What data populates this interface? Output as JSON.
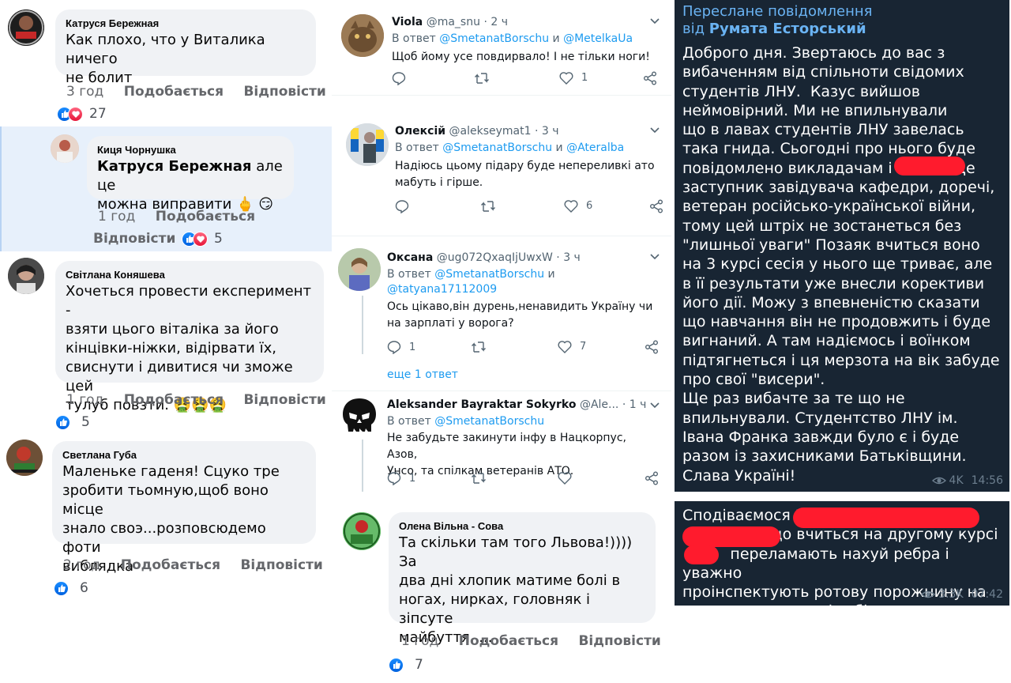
{
  "facebook": {
    "comments": [
      {
        "name": "Катруся Бережная",
        "text_lines": [
          "Как плохо, что у Виталика ничего",
          "не болит"
        ],
        "time": "3 год",
        "like": "Подобається",
        "reply": "Відповісти",
        "reactions": "27"
      },
      {
        "name": "Киця Чорнушка",
        "mention": "Катруся Бережная",
        "text_line1_rest": " але це",
        "text_line2": "можна виправити 🖕 😏",
        "time": "1 год",
        "like": "Подобається",
        "reply": "Відповісти",
        "reactions": "5"
      },
      {
        "name": "Світлана Коняшева",
        "text_lines": [
          "Хочеться провести експеримент -",
          "взяти цього віталіка за його",
          "кінцівки-ніжки, відірвати їх,",
          "свиснути і дивитися чи зможе цей",
          "тулуб повзти. 🤮🤮🤮"
        ],
        "time": "1 год",
        "like": "Подобається",
        "reply": "Відповісти",
        "reactions": "5"
      },
      {
        "name": "Светлана Губа",
        "text_lines": [
          "Маленьке гаденя! Сцуко тре",
          "зробити тьомную,щоб воно місце",
          "знало своэ...розповсюдемо фоти",
          "виблядка"
        ],
        "time": "2 год",
        "like": "Подобається",
        "reply": "Відповісти",
        "reactions": "6"
      },
      {
        "name": "Олена Вільна - Сова",
        "text_lines": [
          "Та скільки там того Львова!)))) За",
          "два дні хлопик матиме болі в",
          "ногах, нирках, головняк і зіпсуте",
          "майбуття. ..."
        ],
        "time": "1 год",
        "like": "Подобається",
        "reply": "Відповісти",
        "reactions": "7"
      }
    ]
  },
  "twitter": {
    "in_reply_word": "В ответ",
    "and_word": "и",
    "more_replies": "еще 1 ответ",
    "tweets": [
      {
        "name": "Viola",
        "handle": "@ma_snu",
        "dot": "·",
        "time": "2 ч",
        "reply_to_1": "@SmetanatBorschu",
        "reply_to_2": "@MetelkaUa",
        "text_lines": [
          "Щоб йому усе повдирвалo! І не тільки ноги!"
        ],
        "replies": "",
        "likes": "1"
      },
      {
        "name": "Олексій",
        "handle": "@alekseymat1",
        "dot": "·",
        "time": "3 ч",
        "reply_to_1": "@SmetanatBorschu",
        "reply_to_2": "@Ateralba",
        "text_lines": [
          "Надіюсь цьому підару буде непереливкі ато",
          "мабуть і гірше."
        ],
        "replies": "",
        "likes": "6"
      },
      {
        "name": "Оксана",
        "handle": "@ug072QxaqIjUwxW",
        "dot": "·",
        "time": "3 ч",
        "reply_to_1": "@SmetanatBorschu",
        "reply_to_2": "@tatyana17112009",
        "text_lines": [
          "Ось цікаво,він дурень,ненавидить Україну чи",
          "на зарплаті у ворога?"
        ],
        "replies": "1",
        "likes": "7"
      },
      {
        "name": "Aleksander Bayraktar Sokyrko",
        "handle": "@Ale...",
        "dot": "·",
        "time": "1 ч",
        "reply_to_1": "@SmetanatBorschu",
        "reply_to_2": "",
        "text_lines": [
          "Не забудьте закинути інфу в Нацкорпус, Азов,",
          "Унсо, та спілкам ветеранів АТО."
        ],
        "replies": "1",
        "likes": ""
      }
    ]
  },
  "telegram": {
    "msg1": {
      "fwd_line1": "Переслане повідомлення",
      "fwd_from": "від",
      "fwd_author": "Румата Есторський",
      "text_lines": [
        "Доброго дня. Звертаюсь до вас з",
        "вибаченням від спільноти свідомих",
        "студентів ЛНУ.  Казус вийшов",
        "неймовірний. Ми не впильнували",
        "що в лавах студентів ЛНУ завелась",
        "така гнида. Сьогодні про нього буде",
        "повідомлено викладачам і           . Де",
        "заступник завідувача кафедри, доречі,",
        "ветеран російсько-української війни,",
        "тому цей штріх не зостанеться без",
        "\"лишньої уваги\" Позаяк вчиться воно",
        "на 3 курсі сесія у нього ще триває, але",
        "в її результати уже внесли корективи",
        "його дії. Можу з впевненістю сказати",
        "що навчання він не продовжить і буде",
        "вигнаний. А там надіємось і воїнком",
        "підтягнеться і ця мерзота на вік забуде",
        "про свої \"висери\".",
        "Ще раз вибачте за те що не",
        "впильнували. Студентство ЛНУ ім.",
        "Івана Франка завжди було є і буде",
        "разом із захисниками Батьківщини.",
        "Слава Україні!"
      ],
      "views": "4K",
      "time": "14:56"
    },
    "msg2": {
      "text_lines": [
        "Сподіваємося I",
        "                  що вчиться на другому курсі",
        "          переламають нахуй ребра і уважно",
        "проінспектують ротову порожнину на",
        "предмет наявності зубів."
      ],
      "views": "3.3K",
      "time": "07:42"
    }
  }
}
